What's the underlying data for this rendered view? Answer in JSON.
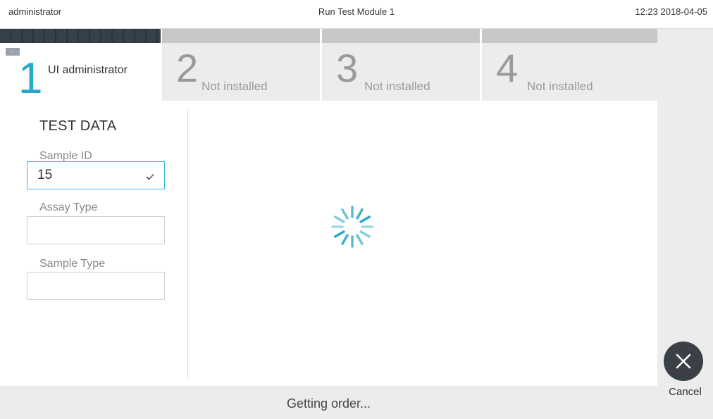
{
  "header": {
    "user": "administrator",
    "title": "Run Test Module 1",
    "datetime": "12:23 2018-04-05"
  },
  "modules": [
    {
      "number": "1",
      "label": "UI administrator",
      "badge": "--:--",
      "active": true
    },
    {
      "number": "2",
      "label": "Not installed",
      "active": false
    },
    {
      "number": "3",
      "label": "Not installed",
      "active": false
    },
    {
      "number": "4",
      "label": "Not installed",
      "active": false
    }
  ],
  "test_data": {
    "heading": "TEST DATA",
    "sample_id_label": "Sample ID",
    "sample_id_value": "15",
    "assay_type_label": "Assay Type",
    "assay_type_value": "",
    "sample_type_label": "Sample Type",
    "sample_type_value": ""
  },
  "actions": {
    "cancel_label": "Cancel"
  },
  "status": {
    "message": "Getting order..."
  },
  "colors": {
    "accent": "#2aa7c9",
    "panel": "#ececec",
    "dark": "#3b4046"
  }
}
